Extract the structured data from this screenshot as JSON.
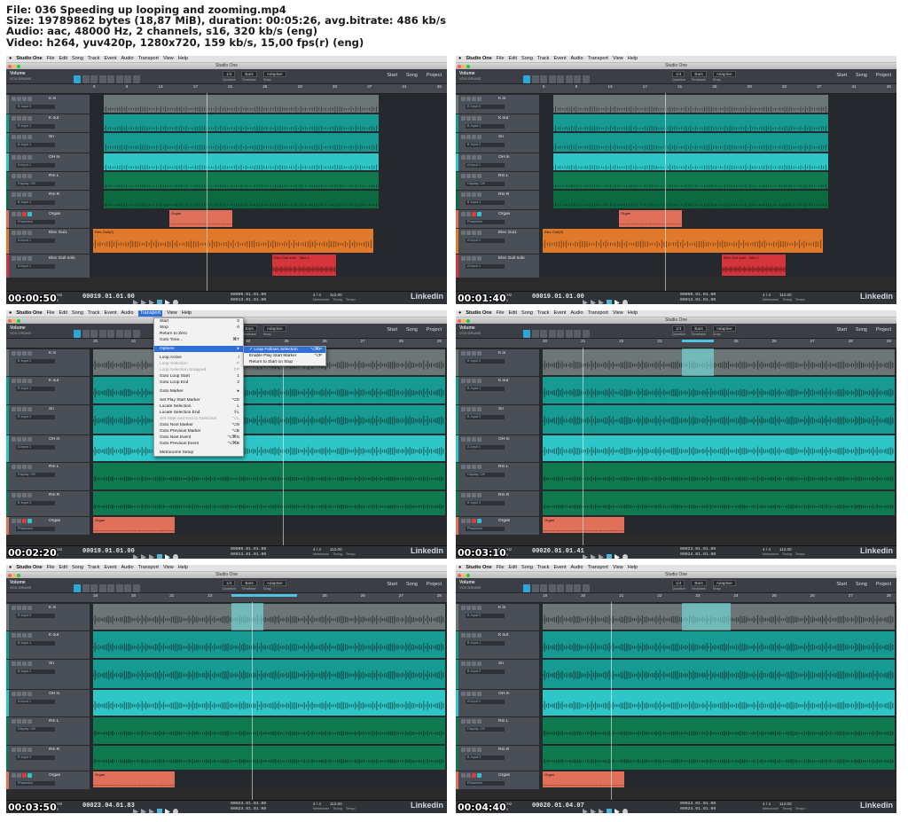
{
  "header": {
    "file": "File: 036 Speeding up looping and zooming.mp4",
    "size": "Size: 19789862 bytes (18,87 MiB), duration: 00:05:26, avg.bitrate: 486 kb/s",
    "audio": "Audio: aac, 48000 Hz, 2 channels, s16, 320 kb/s (eng)",
    "video": "Video: h264, yuv420p, 1280x720, 159 kb/s, 15,00 fps(r) (eng)"
  },
  "app": {
    "menubar": [
      "Studio One",
      "File",
      "Edit",
      "Song",
      "Track",
      "Event",
      "Audio",
      "Transport",
      "View",
      "Help"
    ],
    "window_title": "Studio One",
    "track_name": "Volume",
    "track_sub": "VOX DRUMS",
    "toolbar_right": [
      "Start",
      "Song",
      "Project"
    ],
    "quantize": [
      "1/4",
      "Quantize"
    ],
    "timebase": [
      "Bars",
      "Timebase"
    ],
    "snap": [
      "Adaptive",
      "Snap"
    ],
    "transport_info": [
      "48.0 kHz",
      "0.0 ms"
    ],
    "time_sig": "4 / 4",
    "tempo": "112.00",
    "transport_labels": [
      "Metronome",
      "Timing",
      "Tempo"
    ],
    "logo": "Linkedin"
  },
  "colors": {
    "gray": "#6c7676",
    "teal": "#179a92",
    "teal_light": "#2ec6c6",
    "green": "#0f7a4f",
    "green_dark": "#0c6a40",
    "salmon": "#e0705a",
    "orange": "#e0792a",
    "red": "#d4353a",
    "blue": "#4d7fb8"
  },
  "frames": [
    {
      "stamp": "00:00:50",
      "timecode": "00019.01.01.00",
      "loop": [
        "00009.01.01.00",
        "00013.01.01.00"
      ],
      "ruler": [
        "5",
        "9",
        "13",
        "17",
        "21",
        "25",
        "29",
        "33",
        "37",
        "41",
        "45"
      ]
    },
    {
      "stamp": "00:01:40",
      "timecode": "00019.01.01.00",
      "loop": [
        "00009.01.01.00",
        "00013.01.01.00"
      ],
      "ruler": [
        "5",
        "9",
        "13",
        "17",
        "21",
        "25",
        "29",
        "33",
        "37",
        "41",
        "45"
      ]
    },
    {
      "stamp": "00:02:20",
      "timecode": "00019.01.01.00",
      "loop": [
        "00009.01.01.00",
        "00013.01.01.00"
      ],
      "ruler": [
        "20",
        "21",
        "22",
        "23",
        "24",
        "25",
        "26",
        "27",
        "28",
        "29"
      ]
    },
    {
      "stamp": "00:03:10",
      "timecode": "00020.01.01.41",
      "loop": [
        "00023.01.01.00",
        "00024.01.01.00"
      ],
      "ruler": [
        "20",
        "21",
        "22",
        "23",
        "24",
        "25",
        "26",
        "27",
        "28",
        "29"
      ]
    },
    {
      "stamp": "00:03:50",
      "timecode": "00023.04.01.83",
      "loop": [
        "00023.01.01.00",
        "00024.01.01.00"
      ],
      "ruler": [
        "19",
        "20",
        "21",
        "22",
        "23",
        "24",
        "25",
        "26",
        "27",
        "28"
      ]
    },
    {
      "stamp": "00:04:40",
      "timecode": "00020.01.04.07",
      "loop": [
        "00023.01.01.00",
        "00024.01.01.00"
      ],
      "ruler": [
        "19",
        "20",
        "21",
        "22",
        "23",
        "24",
        "25",
        "26",
        "27",
        "28"
      ]
    }
  ],
  "tracks_full": [
    {
      "name": "K in",
      "input": "B Input 0"
    },
    {
      "name": "K out",
      "input": "B Input 1"
    },
    {
      "name": "Sn",
      "input": "B Input 2"
    },
    {
      "name": "OH m",
      "input": "A Input 1"
    },
    {
      "name": "Rm L",
      "input": "Display: Off"
    },
    {
      "name": "Rm R",
      "input": "B Input 3"
    },
    {
      "name": "Organ",
      "input": "Phaserize"
    },
    {
      "name": "Elec Gui1",
      "input": "A Input 1"
    },
    {
      "name": "Elec Guit solo",
      "input": "A Input 1"
    }
  ],
  "clip_labels": {
    "organ": "Organ",
    "elec_gui": "Elec Guit(2)",
    "elec_solo": "Elec Guit solo - Take 1"
  },
  "transport_menu": {
    "title": "Transport",
    "items": [
      {
        "label": "Start",
        "sc": "0"
      },
      {
        "label": "Stop",
        "sc": "0"
      },
      {
        "label": "Return to Zero",
        "sc": ""
      },
      {
        "label": "Goto Time...",
        "sc": "⌘T"
      },
      {
        "sep": true
      },
      {
        "label": "Options",
        "sc": "▸",
        "hl": true
      },
      {
        "sep": true
      },
      {
        "label": "Loop Active",
        "sc": "/"
      },
      {
        "label": "Loop Selection",
        "sc": "P",
        "dim": true
      },
      {
        "label": "Loop Selection Snapped",
        "sc": "⇧P",
        "dim": true
      },
      {
        "label": "Goto Loop Start",
        "sc": "1"
      },
      {
        "label": "Goto Loop End",
        "sc": "2"
      },
      {
        "sep": true
      },
      {
        "label": "Goto Marker",
        "sc": "▸"
      },
      {
        "sep": true
      },
      {
        "label": "Set Play Start Marker",
        "sc": "⌥D"
      },
      {
        "label": "Locate Selection",
        "sc": "L"
      },
      {
        "label": "Locate Selection End",
        "sc": "⇧L"
      },
      {
        "label": "Set Start and End to Selection",
        "sc": "⌥L",
        "dim": true
      },
      {
        "label": "Goto Next Marker",
        "sc": "⌥N"
      },
      {
        "label": "Goto Previous Marker",
        "sc": "⌥B"
      },
      {
        "label": "Goto Next Event",
        "sc": "⌥⌘N"
      },
      {
        "label": "Goto Previous Event",
        "sc": "⌥⌘B"
      },
      {
        "sep": true
      },
      {
        "label": "Metronome Setup",
        "sc": ""
      }
    ],
    "submenu": [
      {
        "label": "✓ Loop Follows Selection",
        "sc": "⌥⌘P",
        "hl": true
      },
      {
        "label": "Enable Play Start Marker",
        "sc": "⌥P"
      },
      {
        "label": "Return to Start on Stop",
        "sc": ""
      }
    ]
  }
}
